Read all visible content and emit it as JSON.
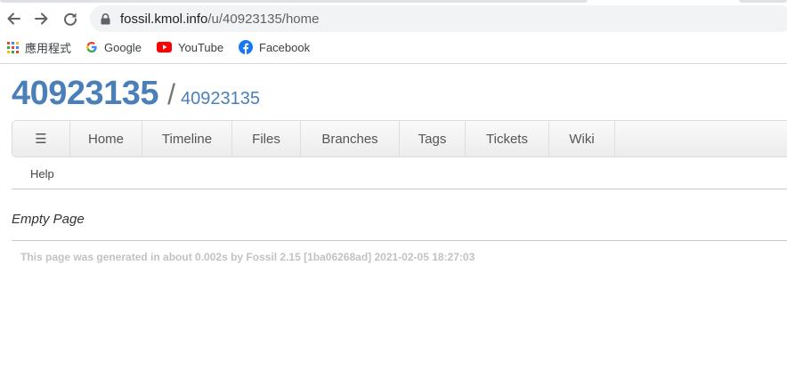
{
  "browser": {
    "url_host": "fossil.kmol.info",
    "url_path": "/u/40923135/home",
    "bookmarks": [
      {
        "label": "應用程式",
        "icon": "apps-grid-icon"
      },
      {
        "label": "Google",
        "icon": "google-icon"
      },
      {
        "label": "YouTube",
        "icon": "youtube-icon"
      },
      {
        "label": "Facebook",
        "icon": "facebook-icon"
      }
    ]
  },
  "header": {
    "title": "40923135",
    "separator": "/",
    "subtitle": "40923135"
  },
  "mainmenu": {
    "hamburger": "☰",
    "items": [
      "Home",
      "Timeline",
      "Files",
      "Branches",
      "Tags",
      "Tickets",
      "Wiki"
    ]
  },
  "submenu": {
    "help": "Help"
  },
  "content": {
    "text": "Empty Page"
  },
  "footer": {
    "text": "This page was generated in about 0.002s by Fossil 2.15 [1ba06268ad] 2021-02-05 18:27:03"
  },
  "colors": {
    "title": "#4a7fba",
    "footer": "#c2c2c2"
  }
}
